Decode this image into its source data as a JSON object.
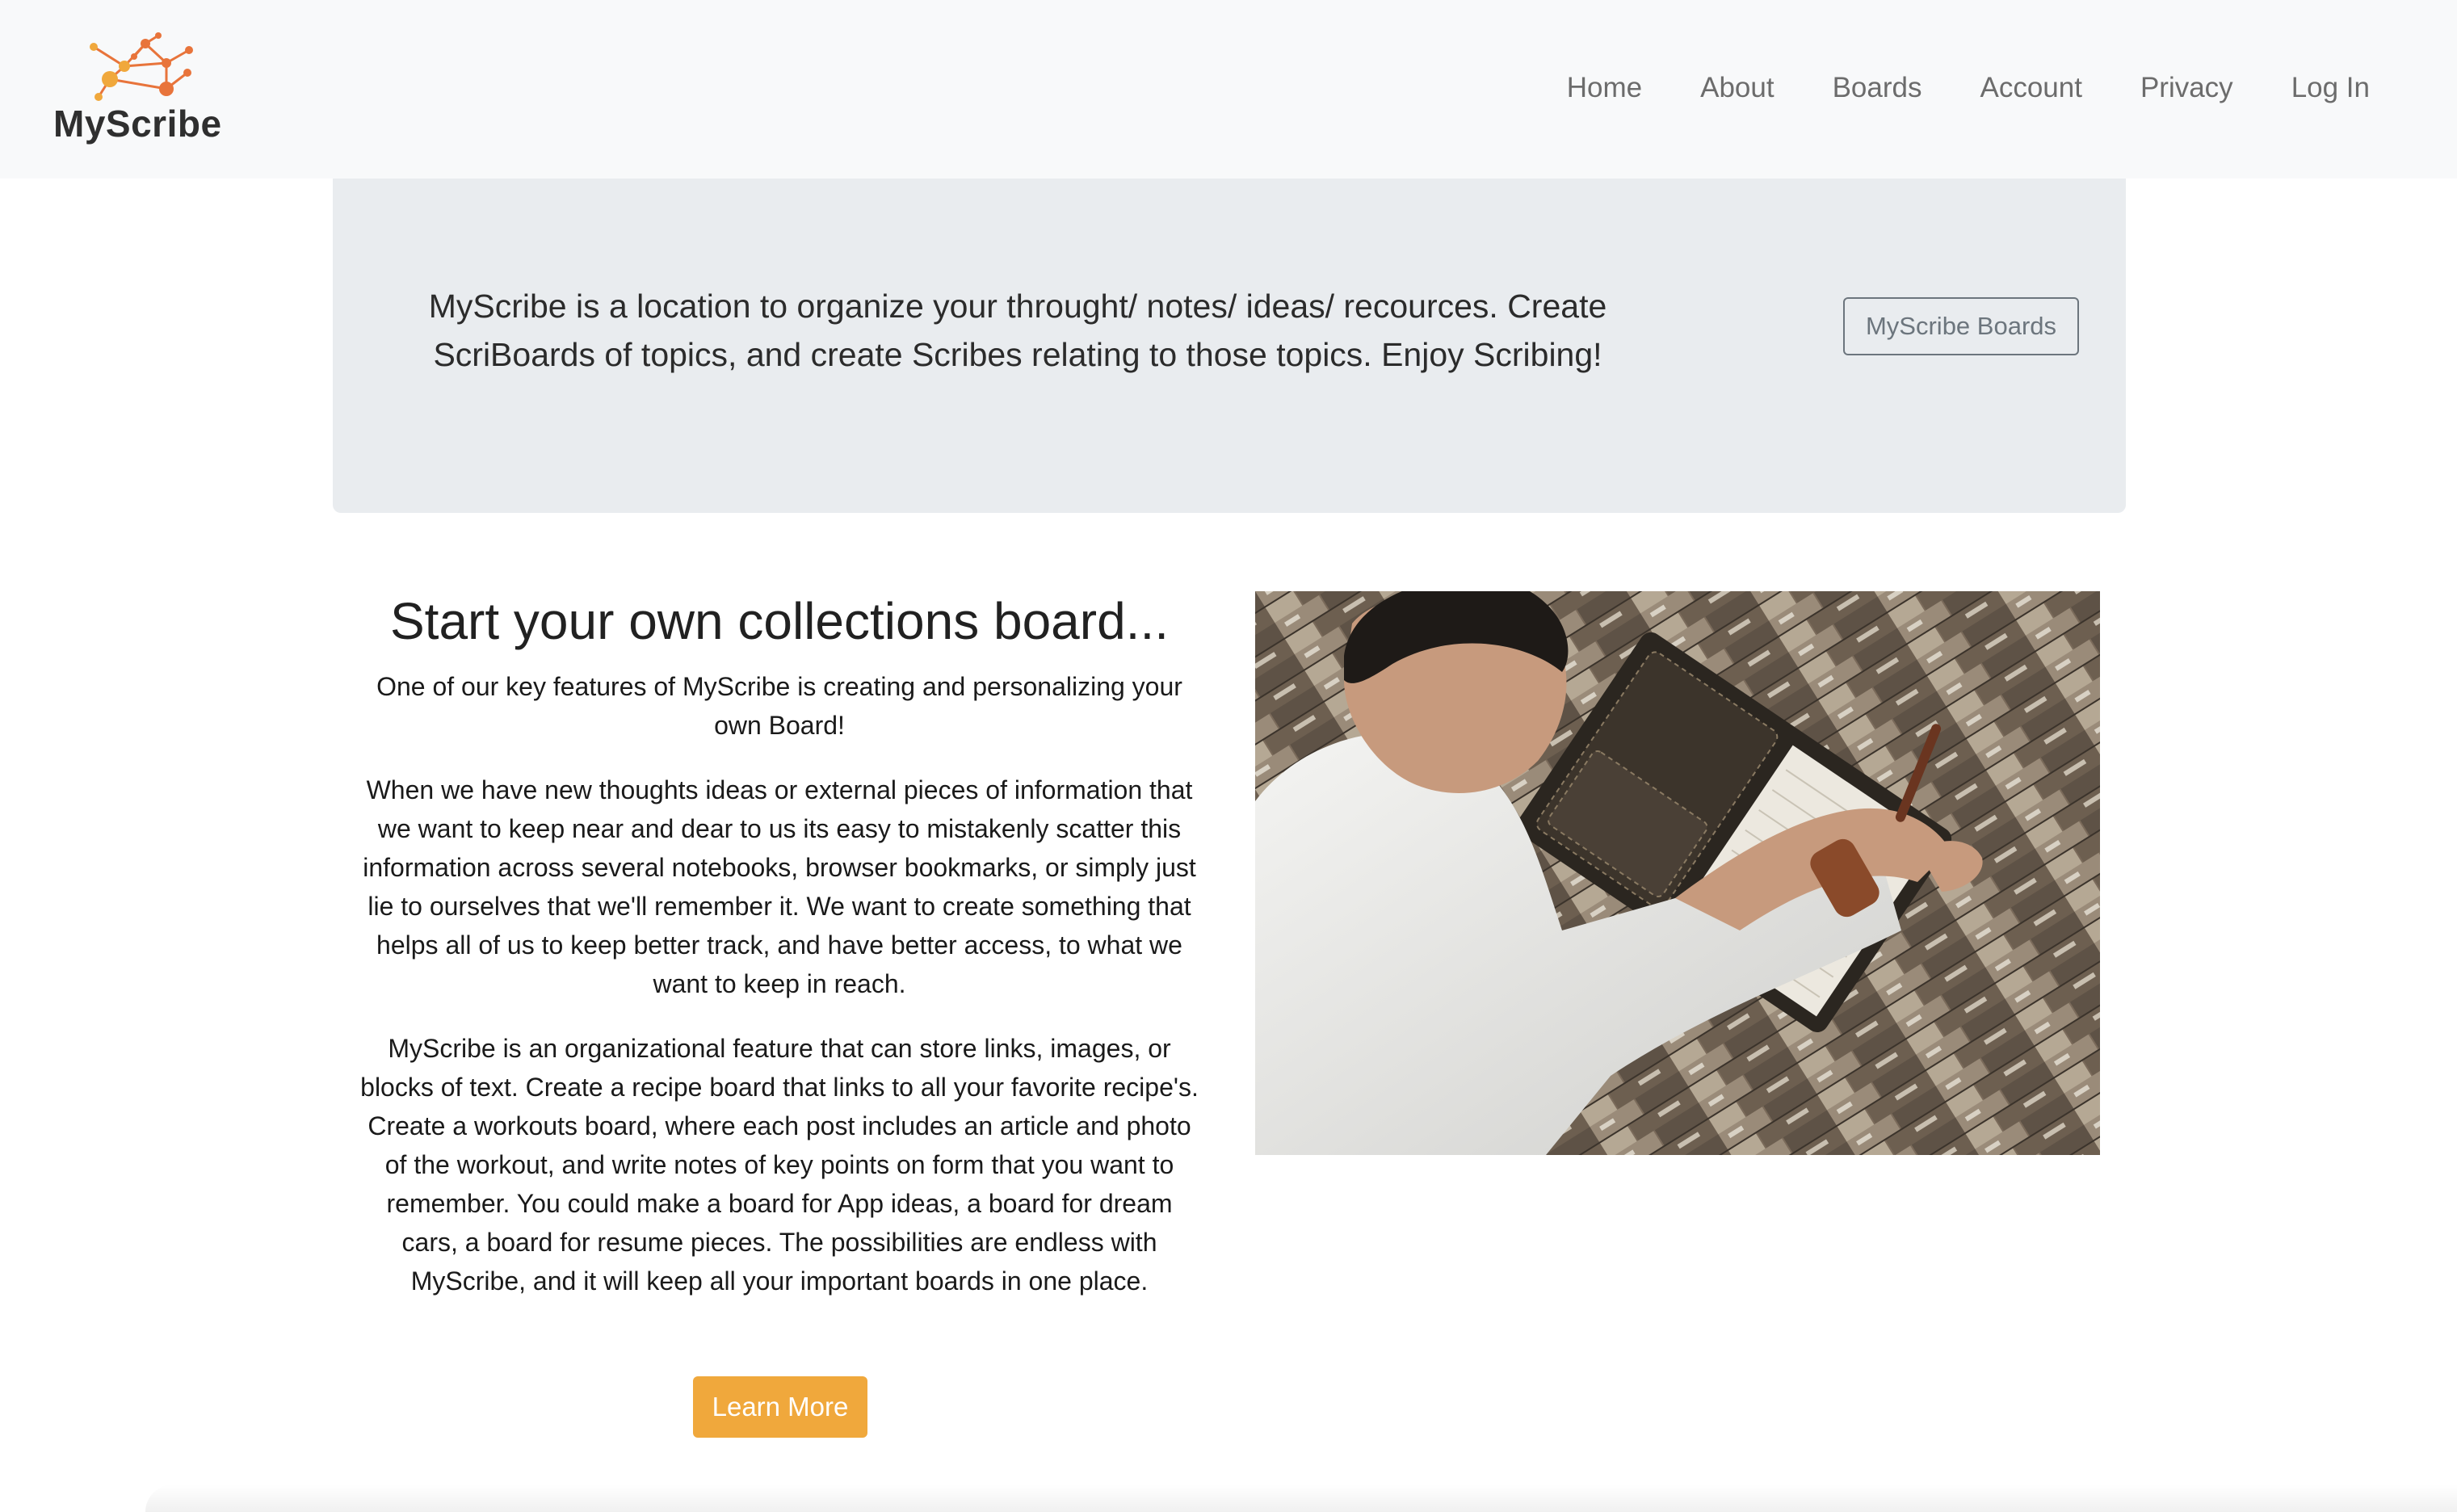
{
  "brand": {
    "name": "MyScribe",
    "accent_color": "#f0a83c",
    "accent_dark": "#e8743b"
  },
  "nav": {
    "items": [
      {
        "label": "Home"
      },
      {
        "label": "About"
      },
      {
        "label": "Boards"
      },
      {
        "label": "Account"
      },
      {
        "label": "Privacy"
      },
      {
        "label": "Log In"
      }
    ]
  },
  "jumbotron": {
    "text": "MyScribe is a location to organize your throught/ notes/ ideas/ recources. Create ScriBoards of topics, and create Scribes relating to those topics. Enjoy Scribing!",
    "button_label": "MyScribe Boards"
  },
  "feature": {
    "title": "Start your own collections board...",
    "paragraph_1": "One of our key features of MyScribe is creating and personalizing your own Board!",
    "paragraph_2": "When we have new thoughts ideas or external pieces of information that we want to keep near and dear to us its easy to mistakenly scatter this information across several notebooks, browser bookmarks, or simply just lie to ourselves that we'll remember it. We want to create something that helps all of us to keep better track, and have better access, to what we want to keep in reach.",
    "paragraph_3": "MyScribe is an organizational feature that can store links, images, or blocks of text. Create a recipe board that links to all your favorite recipe's. Create a workouts board, where each post includes an article and photo of the workout, and write notes of key points on form that you want to remember. You could make a board for App ideas, a board for dream cars, a board for resume pieces. The possibilities are endless with MyScribe, and it will keep all your important boards in one place.",
    "button_label": "Learn More"
  },
  "photo": {
    "icon": "photo-person-writing-notebook"
  }
}
